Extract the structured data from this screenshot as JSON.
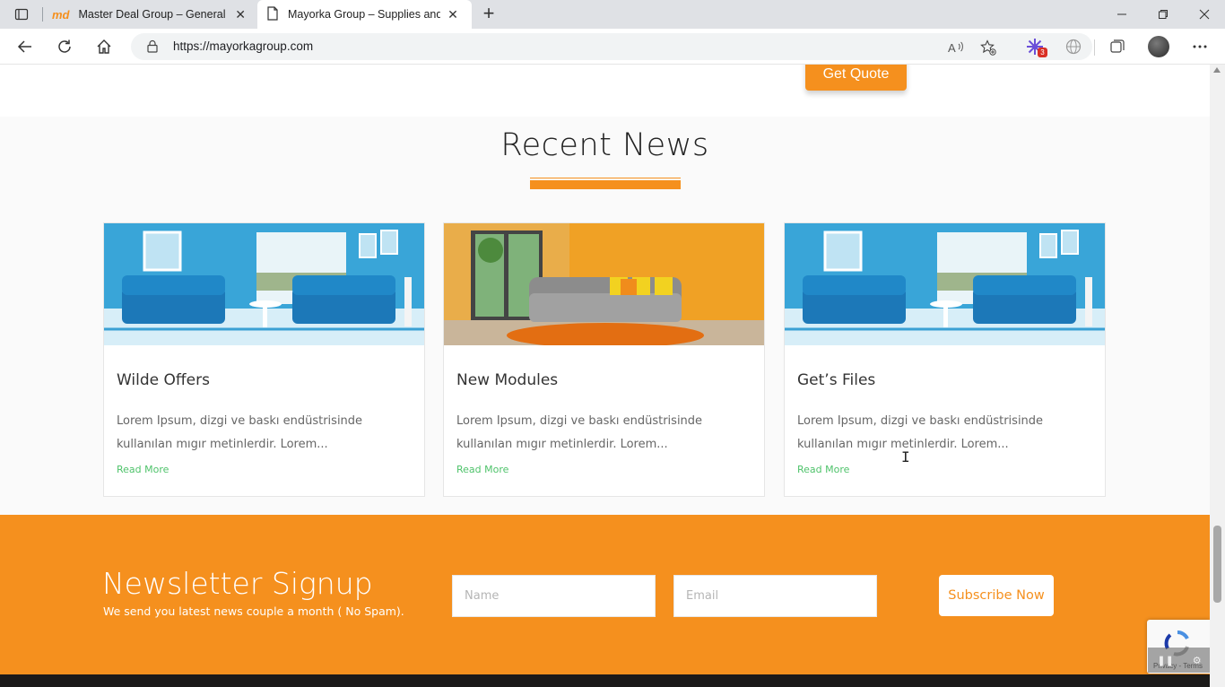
{
  "browser": {
    "tabs": [
      {
        "title": "Master Deal Group – General Tra",
        "favicon": "md-logo-icon"
      },
      {
        "title": "Mayorka Group – Supplies and C",
        "favicon": "page-icon"
      }
    ],
    "url": "https://mayorkagroup.com",
    "extension_badge": "3"
  },
  "page": {
    "get_quote_label": "Get Quote",
    "news_heading": "Recent News",
    "accent_color": "#f5901e",
    "cards": [
      {
        "title": "Wilde Offers",
        "text": "Lorem Ipsum, dizgi ve baskı endüstrisinde kullanılan mıgır metinlerdir. Lorem...",
        "link": "Read More",
        "image": "blue-living-room-photo"
      },
      {
        "title": "New Modules",
        "text": "Lorem Ipsum, dizgi ve baskı endüstrisinde kullanılan mıgır metinlerdir. Lorem...",
        "link": "Read More",
        "image": "orange-living-room-photo"
      },
      {
        "title": "Get’s Files",
        "text": "Lorem Ipsum, dizgi ve baskı endüstrisinde kullanılan mıgır metinlerdir. Lorem...",
        "link": "Read More",
        "image": "blue-living-room-photo"
      }
    ],
    "newsletter": {
      "title": "Newsletter Signup",
      "subtitle": "We send you latest news couple a month ( No Spam).",
      "name_placeholder": "Name",
      "email_placeholder": "Email",
      "button": "Subscribe Now"
    },
    "recaptcha_text": "Privacy - Terms"
  }
}
